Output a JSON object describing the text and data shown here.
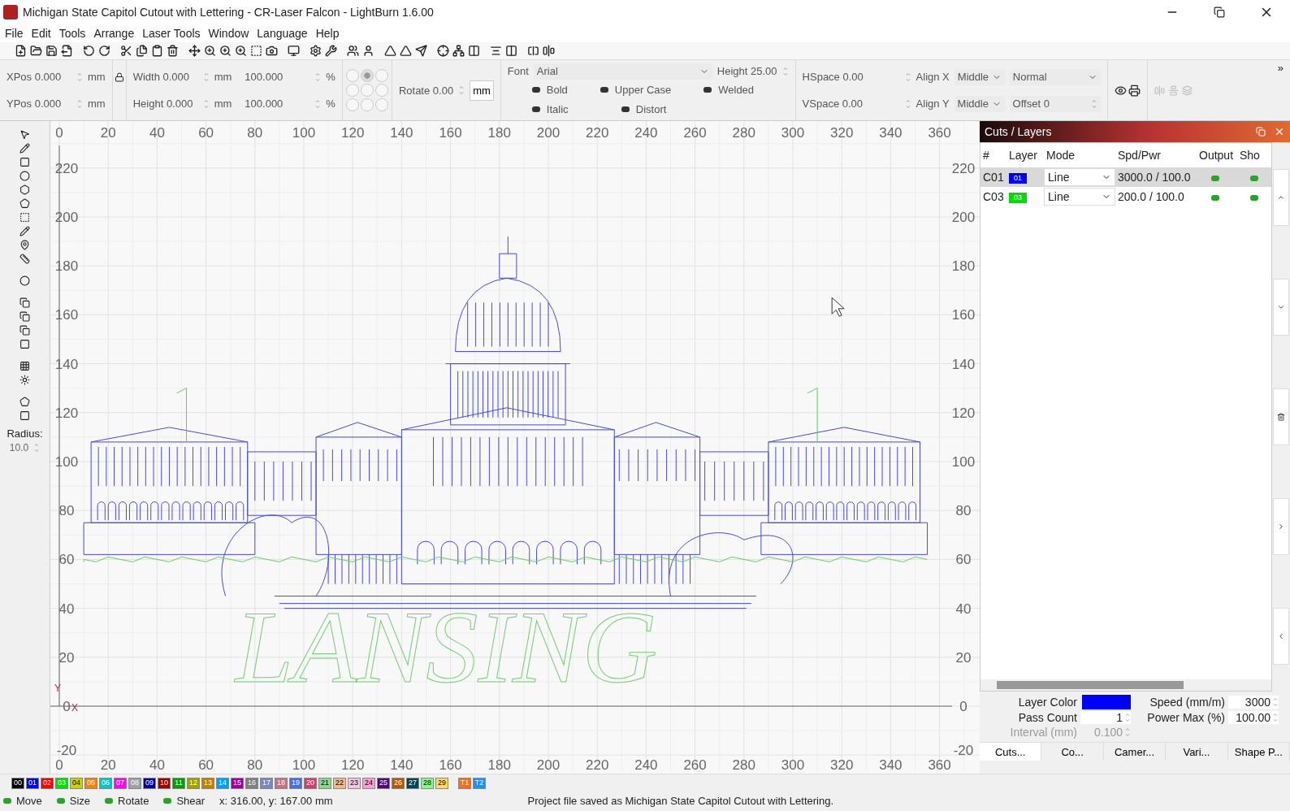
{
  "window": {
    "title": "Michigan State Capitol Cutout with Lettering - CR-Laser Falcon - LightBurn 1.6.00"
  },
  "menu": [
    "File",
    "Edit",
    "Tools",
    "Arrange",
    "Laser Tools",
    "Window",
    "Language",
    "Help"
  ],
  "properties": {
    "xpos": {
      "label": "XPos",
      "value": "0.000",
      "unit": "mm"
    },
    "ypos": {
      "label": "YPos",
      "value": "0.000",
      "unit": "mm"
    },
    "width": {
      "label": "Width",
      "value": "0.000",
      "unit": "mm",
      "percent": "100.000",
      "percent_unit": "%"
    },
    "height": {
      "label": "Height",
      "value": "0.000",
      "unit": "mm",
      "percent": "100.000",
      "percent_unit": "%"
    },
    "anchors": [
      {
        "selected": false
      },
      {
        "selected": true
      },
      {
        "selected": false
      },
      {
        "selected": false
      },
      {
        "selected": false
      },
      {
        "selected": false
      },
      {
        "selected": false
      },
      {
        "selected": false
      },
      {
        "selected": false
      }
    ],
    "rotate": {
      "label": "Rotate",
      "value": "0.00"
    },
    "unit_button": "mm"
  },
  "text_tools": {
    "font": {
      "label": "Font",
      "value": "Arial"
    },
    "height": {
      "label": "Height",
      "value": "25.00"
    },
    "toggles": [
      {
        "label": "Bold",
        "on": false
      },
      {
        "label": "Italic",
        "on": false
      },
      {
        "label": "Upper Case",
        "on": false
      },
      {
        "label": "Distort",
        "on": false
      },
      {
        "label": "Welded",
        "on": false
      }
    ],
    "hspace": {
      "label": "HSpace",
      "value": "0.00"
    },
    "vspace": {
      "label": "VSpace",
      "value": "0.00"
    },
    "align_x": {
      "label": "Align X",
      "value": "Middle"
    },
    "align_y": {
      "label": "Align Y",
      "value": "Middle"
    },
    "style": "Normal",
    "offset": {
      "label": "Offset",
      "value": "0"
    },
    "more": "»"
  },
  "tools": {
    "radius": {
      "label": "Radius:",
      "value": "10.0"
    }
  },
  "canvas": {
    "top_x_ticks": [
      "0",
      "20",
      "40",
      "60",
      "80",
      "100",
      "120",
      "140",
      "160",
      "180",
      "200",
      "220",
      "240",
      "260",
      "280",
      "300",
      "320",
      "340",
      "360"
    ],
    "bottom_x_ticks": [
      "0",
      "20",
      "40",
      "60",
      "80",
      "100",
      "120",
      "140",
      "160",
      "180",
      "200",
      "220",
      "240",
      "260",
      "280",
      "300",
      "320",
      "340",
      "360"
    ],
    "left_y_ticks": [
      "220",
      "200",
      "180",
      "160",
      "140",
      "120",
      "100",
      "80",
      "60",
      "40",
      "20",
      "0",
      "-20"
    ],
    "right_y_ticks": [
      "220",
      "200",
      "180",
      "160",
      "140",
      "120",
      "100",
      "80",
      "60",
      "40",
      "20",
      "0",
      "-20"
    ],
    "x_axis_label": "X",
    "y_axis_label": "Y",
    "lettering": "LANSING"
  },
  "cuts_panel": {
    "title": "Cuts / Layers",
    "columns": [
      "#",
      "Layer",
      "Mode",
      "Spd/Pwr",
      "Output",
      "Sho"
    ],
    "rows": [
      {
        "id": "C01",
        "layer": "01",
        "color": "#0000ff",
        "mode": "Line",
        "spd_pwr": "3000.0 / 100.0",
        "output": true,
        "show": true,
        "selected": true
      },
      {
        "id": "C03",
        "layer": "03",
        "color": "#00dd00",
        "mode": "Line",
        "spd_pwr": "200.0 / 100.0",
        "output": true,
        "show": true,
        "selected": false
      }
    ],
    "layer_color": {
      "label": "Layer Color",
      "color": "#0000ff"
    },
    "speed": {
      "label": "Speed (mm/m)",
      "value": "3000"
    },
    "pass_count": {
      "label": "Pass Count",
      "value": "1"
    },
    "power_max": {
      "label": "Power Max (%)",
      "value": "100.00"
    },
    "interval": {
      "label": "Interval (mm)",
      "value": "0.100",
      "disabled": true
    },
    "tabs": [
      {
        "label": "Cuts...",
        "selected": true
      },
      {
        "label": "Co...",
        "selected": false
      },
      {
        "label": "Camer...",
        "selected": false
      },
      {
        "label": "Vari...",
        "selected": false
      },
      {
        "label": "Shape P...",
        "selected": false
      }
    ]
  },
  "palette": [
    {
      "label": "00",
      "color": "#000000"
    },
    {
      "label": "01",
      "color": "#0000ff"
    },
    {
      "label": "02",
      "color": "#ff0000"
    },
    {
      "label": "03",
      "color": "#00e000"
    },
    {
      "label": "04",
      "color": "#d0d000"
    },
    {
      "label": "05",
      "color": "#ff8000"
    },
    {
      "label": "06",
      "color": "#00c8c8"
    },
    {
      "label": "07",
      "color": "#ff00ff"
    },
    {
      "label": "08",
      "color": "#a0a0a0"
    },
    {
      "label": "09",
      "color": "#0000a0"
    },
    {
      "label": "10",
      "color": "#a00000"
    },
    {
      "label": "11",
      "color": "#00a000"
    },
    {
      "label": "12",
      "color": "#a0a000"
    },
    {
      "label": "13",
      "color": "#c08000"
    },
    {
      "label": "14",
      "color": "#00a0ff"
    },
    {
      "label": "15",
      "color": "#a000a0"
    },
    {
      "label": "16",
      "color": "#808080"
    },
    {
      "label": "17",
      "color": "#7d87b9"
    },
    {
      "label": "18",
      "color": "#bb7784"
    },
    {
      "label": "19",
      "color": "#4a6fe3"
    },
    {
      "label": "20",
      "color": "#d33f6a"
    },
    {
      "label": "21",
      "color": "#8cd78c"
    },
    {
      "label": "22",
      "color": "#f0b98d"
    },
    {
      "label": "23",
      "color": "#f6c4e1"
    },
    {
      "label": "24",
      "color": "#fa9ed4"
    },
    {
      "label": "25",
      "color": "#500a78"
    },
    {
      "label": "26",
      "color": "#b45a00"
    },
    {
      "label": "27",
      "color": "#004754"
    },
    {
      "label": "28",
      "color": "#86fa88"
    },
    {
      "label": "29",
      "color": "#ffdb66"
    },
    {
      "label": "T1",
      "color": "#f37020"
    },
    {
      "label": "T2",
      "color": "#1e90ff"
    }
  ],
  "status_bar": {
    "modes": [
      "Move",
      "Size",
      "Rotate",
      "Shear"
    ],
    "coords": "x: 316.00, y: 167.00 mm",
    "message": "Project file saved as Michigan State Capitol Cutout with Lettering."
  }
}
